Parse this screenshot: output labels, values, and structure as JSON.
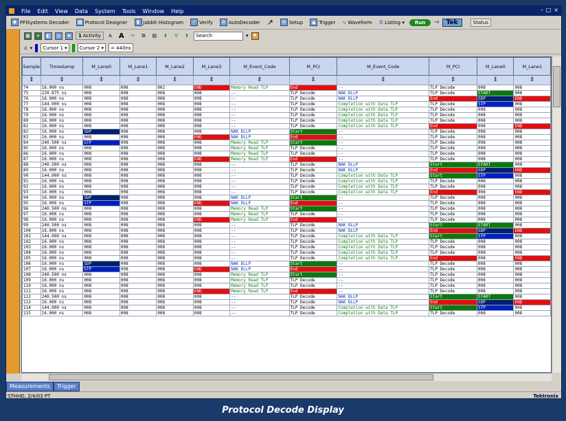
{
  "menu": [
    "File",
    "Edit",
    "View",
    "Data",
    "System",
    "Tools",
    "Window",
    "Help"
  ],
  "window_controls": [
    "–",
    "□",
    "×"
  ],
  "toolbar1": {
    "items": [
      "PFISystems Decoder",
      "Protocol Designer",
      "Jabbit Histogram",
      "Verify",
      "AutoDecoder",
      "Setup",
      "Trigger",
      "Waveform",
      "Listing ▾"
    ],
    "run_label": "Run",
    "logo": "Tek",
    "status_label": "Status"
  },
  "toolbar2": {
    "activity_label": "Activity",
    "search_label": "Search",
    "search_placeholder": "Search"
  },
  "toolbar3": {
    "cursor1": "Cursor 1 ▾",
    "cursor2": "Cursor 2 ▾",
    "delta": "= 440ns"
  },
  "table": {
    "columns": [
      "Sample",
      "Timestamp",
      "M_Lane0",
      "M_Lane1",
      "M_Lane2",
      "M_Lane3",
      "M_Event_Code",
      "M_PCI",
      "M_Event_Code",
      "M_PCI",
      "M_Lane0",
      "M_Lane1"
    ],
    "filter_symbol": "‡",
    "rows": [
      [
        "74",
        "16.000 ns",
        "008",
        "008",
        "002",
        "END",
        "Memory Read TLP",
        "End",
        "--",
        "TLP Decode",
        "008",
        "008"
      ],
      [
        "75",
        "220.875 ns",
        "008",
        "008",
        "008",
        "008",
        "--",
        "TLP Decode",
        "NAK DLLP",
        "TLP Decode",
        "START",
        "008"
      ],
      [
        "76",
        "16.000 ns",
        "008",
        "008",
        "008",
        "008",
        "--",
        "TLP Decode",
        "NAK DLLP",
        "End",
        "SDP",
        "END"
      ],
      [
        "77",
        "144.000 ns",
        "008",
        "008",
        "008",
        "008",
        "--",
        "TLP Decode",
        "Completion with Data TLP",
        "TLP Decode",
        "STP",
        "008"
      ],
      [
        "78",
        "16.000 ns",
        "008",
        "008",
        "008",
        "008",
        "--",
        "TLP Decode",
        "Completion with Data TLP",
        "TLP Decode",
        "008",
        "008"
      ],
      [
        "79",
        "16.000 ns",
        "008",
        "008",
        "008",
        "008",
        "--",
        "TLP Decode",
        "Completion with Data TLP",
        "TLP Decode",
        "008",
        "008"
      ],
      [
        "80",
        "16.000 ns",
        "008",
        "008",
        "008",
        "008",
        "--",
        "TLP Decode",
        "Completion with Data TLP",
        "TLP Decode",
        "008",
        "008"
      ],
      [
        "81",
        "16.000 ns",
        "008",
        "008",
        "008",
        "008",
        "--",
        "TLP Decode",
        "Completion with Data TLP",
        "End",
        "008",
        "END"
      ],
      [
        "82",
        "16.000 ns",
        "SDP",
        "008",
        "008",
        "008",
        "NAK DLLP",
        "Start",
        "--",
        "TLP Decode",
        "008",
        "008"
      ],
      [
        "83",
        "16.000 ns",
        "008",
        "008",
        "008",
        "END",
        "NAK DLLP",
        "End",
        "--",
        "TLP Decode",
        "008",
        "008"
      ],
      [
        "84",
        "240.500 ns",
        "STP",
        "008",
        "008",
        "008",
        "Memory Read TLP",
        "Start",
        "--",
        "TLP Decode",
        "008",
        "008"
      ],
      [
        "85",
        "16.000 ns",
        "008",
        "008",
        "008",
        "008",
        "Memory Read TLP",
        "TLP Decode",
        "--",
        "TLP Decode",
        "008",
        "008"
      ],
      [
        "86",
        "16.000 ns",
        "008",
        "008",
        "008",
        "008",
        "Memory Read TLP",
        "TLP Decode",
        "--",
        "TLP Decode",
        "008",
        "008"
      ],
      [
        "87",
        "16.000 ns",
        "008",
        "008",
        "008",
        "END",
        "Memory Read TLP",
        "End",
        "--",
        "TLP Decode",
        "008",
        "008"
      ],
      [
        "88",
        "240.500 ns",
        "008",
        "008",
        "008",
        "008",
        "--",
        "TLP Decode",
        "NAK DLLP",
        "Start",
        "START",
        "008"
      ],
      [
        "89",
        "16.000 ns",
        "008",
        "008",
        "008",
        "008",
        "--",
        "TLP Decode",
        "NAK DLLP",
        "End",
        "SDP",
        "END"
      ],
      [
        "90",
        "144.000 ns",
        "008",
        "008",
        "008",
        "008",
        "--",
        "TLP Decode",
        "Completion with Data TLP",
        "Start",
        "STP",
        "008"
      ],
      [
        "91",
        "16.000 ns",
        "008",
        "008",
        "008",
        "008",
        "--",
        "TLP Decode",
        "Completion with Data TLP",
        "TLP Decode",
        "008",
        "008"
      ],
      [
        "92",
        "16.000 ns",
        "008",
        "008",
        "008",
        "008",
        "--",
        "TLP Decode",
        "Completion with Data TLP",
        "TLP Decode",
        "008",
        "008"
      ],
      [
        "93",
        "16.000 ns",
        "008",
        "008",
        "008",
        "008",
        "--",
        "TLP Decode",
        "Completion with Data TLP",
        "End",
        "008",
        "END"
      ],
      [
        "94",
        "16.000 ns",
        "SDP",
        "008",
        "008",
        "008",
        "NAK DLLP",
        "Start",
        "--",
        "TLP Decode",
        "008",
        "008"
      ],
      [
        "95",
        "16.000 ns",
        "STP",
        "008",
        "008",
        "END",
        "NAK DLLP",
        "End",
        "--",
        "TLP Decode",
        "008",
        "008"
      ],
      [
        "96",
        "240.500 ns",
        "008",
        "008",
        "008",
        "008",
        "Memory Read TLP",
        "Start",
        "--",
        "TLP Decode",
        "008",
        "008"
      ],
      [
        "97",
        "16.000 ns",
        "008",
        "008",
        "008",
        "008",
        "Memory Read TLP",
        "TLP Decode",
        "--",
        "TLP Decode",
        "008",
        "008"
      ],
      [
        "98",
        "16.000 ns",
        "008",
        "008",
        "008",
        "END",
        "Memory Read TLP",
        "End",
        "--",
        "TLP Decode",
        "008",
        "008"
      ],
      [
        "99",
        "240.500 ns",
        "008",
        "008",
        "008",
        "008",
        "--",
        "TLP Decode",
        "NAK DLLP",
        "Start",
        "START",
        "008"
      ],
      [
        "100",
        "16.000 ns",
        "008",
        "008",
        "008",
        "008",
        "--",
        "TLP Decode",
        "NAK DLLP",
        "End",
        "SDP",
        "END"
      ],
      [
        "101",
        "144.000 ns",
        "008",
        "008",
        "008",
        "008",
        "--",
        "TLP Decode",
        "Completion with Data TLP",
        "Start",
        "STP",
        "008"
      ],
      [
        "102",
        "16.000 ns",
        "008",
        "008",
        "008",
        "008",
        "--",
        "TLP Decode",
        "Completion with Data TLP",
        "TLP Decode",
        "008",
        "008"
      ],
      [
        "103",
        "16.000 ns",
        "008",
        "008",
        "008",
        "008",
        "--",
        "TLP Decode",
        "Completion with Data TLP",
        "TLP Decode",
        "008",
        "008"
      ],
      [
        "104",
        "16.000 ns",
        "008",
        "008",
        "008",
        "008",
        "--",
        "TLP Decode",
        "Completion with Data TLP",
        "TLP Decode",
        "008",
        "008"
      ],
      [
        "105",
        "16.000 ns",
        "008",
        "008",
        "008",
        "008",
        "--",
        "TLP Decode",
        "Completion with Data TLP",
        "End",
        "008",
        "END"
      ],
      [
        "106",
        "16.000 ns",
        "SDP",
        "008",
        "008",
        "008",
        "NAK DLLP",
        "Start",
        "--",
        "TLP Decode",
        "008",
        "008"
      ],
      [
        "107",
        "16.000 ns",
        "STP",
        "008",
        "008",
        "END",
        "NAK DLLP",
        "End",
        "--",
        "TLP Decode",
        "008",
        "008"
      ],
      [
        "108",
        "240.500 ns",
        "008",
        "008",
        "008",
        "008",
        "Memory Read TLP",
        "Start",
        "--",
        "TLP Decode",
        "008",
        "008"
      ],
      [
        "109",
        "16.000 ns",
        "008",
        "008",
        "008",
        "008",
        "Memory Read TLP",
        "TLP Decode",
        "--",
        "TLP Decode",
        "008",
        "008"
      ],
      [
        "110",
        "16.000 ns",
        "008",
        "008",
        "008",
        "008",
        "Memory Read TLP",
        "TLP Decode",
        "--",
        "TLP Decode",
        "008",
        "008"
      ],
      [
        "111",
        "16.000 ns",
        "008",
        "008",
        "008",
        "END",
        "Memory Read TLP",
        "End",
        "--",
        "TLP Decode",
        "008",
        "008"
      ],
      [
        "112",
        "240.500 ns",
        "008",
        "008",
        "008",
        "008",
        "--",
        "TLP Decode",
        "NAK DLLP",
        "Start",
        "START",
        "008"
      ],
      [
        "113",
        "16.000 ns",
        "008",
        "008",
        "008",
        "008",
        "--",
        "TLP Decode",
        "NAK DLLP",
        "End",
        "SDP",
        "END"
      ],
      [
        "114",
        "144.000 ns",
        "008",
        "008",
        "008",
        "008",
        "--",
        "TLP Decode",
        "Completion with Data TLP",
        "Start",
        "STP",
        "008"
      ],
      [
        "115",
        "16.000 ns",
        "008",
        "008",
        "008",
        "008",
        "--",
        "TLP Decode",
        "Completion with Data TLP",
        "TLP Decode",
        "008",
        "008"
      ]
    ]
  },
  "tabs": [
    "Measurements",
    "Trigger"
  ],
  "status": {
    "left": "STHHD, 2/4/03 PT",
    "right": "Tektronix"
  },
  "caption": "Protocol Decode Display"
}
